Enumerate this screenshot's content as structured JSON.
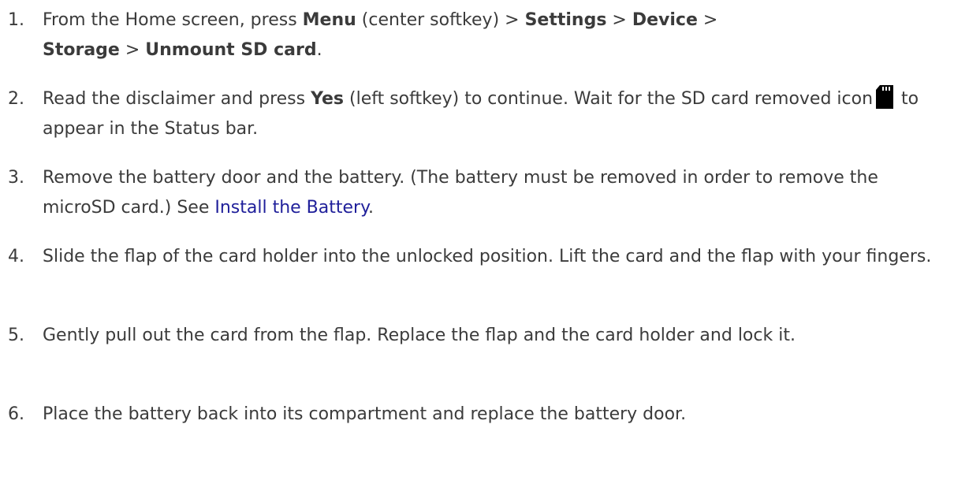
{
  "steps": [
    {
      "number": "1.",
      "t1": "From the Home screen, press ",
      "k1": "Menu",
      "t2": " (center softkey) > ",
      "k2": "Settings",
      "t3": " > ",
      "k3": "Device",
      "t4": " > ",
      "k4": "Storage",
      "t5": " > ",
      "k5": "Unmount SD card",
      "t6": "."
    },
    {
      "number": "2.",
      "t1": "Read the disclaimer and press ",
      "k1": "Yes",
      "t2": " (left softkey) to continue. Wait for the SD card removed icon",
      "t3": "to appear in the Status bar."
    },
    {
      "number": "3.",
      "t1": "Remove the battery door and the battery. (The battery must be removed in order to remove the microSD card.) See ",
      "link": "Install the Battery",
      "t2": "."
    },
    {
      "number": "4.",
      "text": "Slide the flap of the card holder into the unlocked position. Lift the card and the flap with your fingers."
    },
    {
      "number": "5.",
      "text": "Gently pull out the card from the flap. Replace the flap and the card holder and lock it."
    },
    {
      "number": "6.",
      "text": "Place the battery back into its compartment and replace the battery door."
    }
  ],
  "icons": {
    "sd_card": "sd-card-removed-icon"
  },
  "colors": {
    "text": "#3b3b3b",
    "link": "#1f1f9a"
  }
}
